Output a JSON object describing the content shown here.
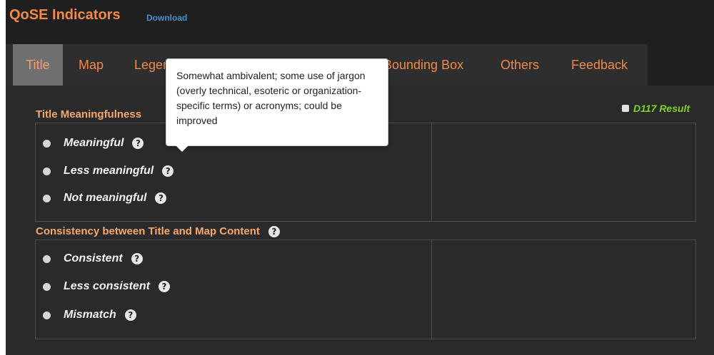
{
  "header": {
    "title": "QoSE Indicators",
    "download_label": "Download"
  },
  "tabs": [
    {
      "label": "Title",
      "active": true
    },
    {
      "label": "Map",
      "active": false
    },
    {
      "label": "Legend",
      "active": false
    },
    {
      "label": "Bounding Box",
      "active": false
    },
    {
      "label": "Others",
      "active": false
    },
    {
      "label": "Feedback",
      "active": false
    }
  ],
  "result_toggle": {
    "label": "D117 Result",
    "checked": false
  },
  "sections": [
    {
      "heading": "Title Meaningfulness",
      "options": [
        "Meaningful",
        "Less meaningful",
        "Not meaningful"
      ]
    },
    {
      "heading": "Consistency between Title and Map Content",
      "options": [
        "Consistent",
        "Less consistent",
        "Mismatch"
      ]
    }
  ],
  "tooltip": {
    "text": "Somewhat ambivalent; some use of jargon (overly technical, esoteric or organization-specific terms) or acronyms; could be improved"
  },
  "icons": {
    "help": "question-circle-icon",
    "bullet": "radio-bullet-icon"
  },
  "colors": {
    "accent_orange": "#f08a4b",
    "link_blue": "#4a8fd6",
    "result_green": "#7ed321",
    "background": "#1f1f1f"
  }
}
